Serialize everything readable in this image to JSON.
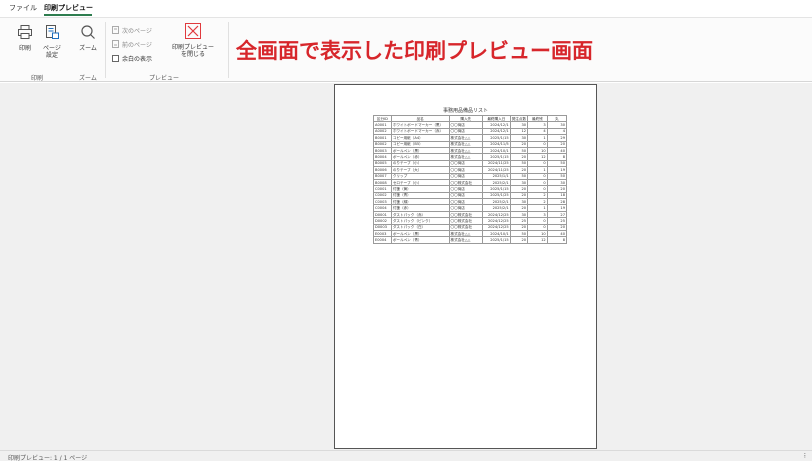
{
  "menu": {
    "file": "ファイル",
    "print_preview": "印刷プレビュー"
  },
  "ribbon": {
    "print_label": "印刷",
    "page_setup_label": "ページ\n設定",
    "zoom_label": "ズーム",
    "next_page_label": "次のページ",
    "prev_page_label": "前のページ",
    "show_margins_label": "余白の表示",
    "close_preview_label": "印刷プレビュー\nを閉じる",
    "group_print": "印刷",
    "group_zoom": "ズーム",
    "group_preview": "プレビュー"
  },
  "banner": "全画面で表示した印刷プレビュー画面",
  "accent_color": "#d7262b",
  "document": {
    "title": "事務用品備品リスト",
    "headers": [
      "区分ID",
      "品名",
      "購入先",
      "最終購入日",
      "発注点数",
      "最終残",
      "丸"
    ],
    "rows": [
      [
        "A0001",
        "ホワイトボードマーカー（黒）",
        "〇〇商店",
        "2024/12/1",
        "30",
        "3",
        "30"
      ],
      [
        "A0002",
        "ホワイトボードマーカー（赤）",
        "〇〇商店",
        "2024/12/1",
        "12",
        "4",
        "4"
      ],
      [
        "B0001",
        "コピー用紙（A4）",
        "株式会社△△",
        "2025/1/15",
        "30",
        "1",
        "29"
      ],
      [
        "B0002",
        "コピー用紙（B5）",
        "株式会社△△",
        "2024/11/5",
        "20",
        "0",
        "20"
      ],
      [
        "B0003",
        "ボールペン（黒）",
        "株式会社△△",
        "2024/10/1",
        "50",
        "10",
        "40"
      ],
      [
        "B0004",
        "ボールペン（赤）",
        "株式会社△△",
        "2025/1/15",
        "20",
        "12",
        "8"
      ],
      [
        "B0005",
        "のりテープ（小）",
        "〇〇商店",
        "2024/11/25",
        "50",
        "0",
        "50"
      ],
      [
        "B0006",
        "のりテープ（大）",
        "〇〇商店",
        "2024/11/25",
        "20",
        "1",
        "19"
      ],
      [
        "B0007",
        "クリップ",
        "〇〇商店",
        "2025/1/1",
        "50",
        "0",
        "50"
      ],
      [
        "B0008",
        "セロテープ（小）",
        "〇〇株式会社",
        "2025/2/1",
        "30",
        "0",
        "30"
      ],
      [
        "C0001",
        "付箋（黄）",
        "〇〇商店",
        "2025/1/15",
        "20",
        "0",
        "20"
      ],
      [
        "C0002",
        "付箋（青）",
        "〇〇商店",
        "2025/1/25",
        "20",
        "2",
        "18"
      ],
      [
        "C0003",
        "付箋（緑）",
        "〇〇商店",
        "2025/2/1",
        "30",
        "2",
        "28"
      ],
      [
        "C0004",
        "付箋（赤）",
        "〇〇商店",
        "2025/2/1",
        "20",
        "1",
        "19"
      ],
      [
        "D0001",
        "ダストパック（赤）",
        "〇〇株式会社",
        "2024/12/25",
        "30",
        "3",
        "27"
      ],
      [
        "D0002",
        "ダストパック（ピンク）",
        "〇〇株式会社",
        "2024/12/25",
        "25",
        "0",
        "25"
      ],
      [
        "D0003",
        "ダストパック（白）",
        "〇〇株式会社",
        "2024/12/25",
        "20",
        "0",
        "20"
      ],
      [
        "E0003",
        "ボールペン（黒）",
        "株式会社△△",
        "2024/10/1",
        "50",
        "10",
        "40"
      ],
      [
        "E0004",
        "ボールペン（青）",
        "株式会社△△",
        "2025/1/15",
        "20",
        "12",
        "8"
      ]
    ]
  },
  "status": {
    "text": "印刷プレビュー: 1 / 1 ページ"
  }
}
